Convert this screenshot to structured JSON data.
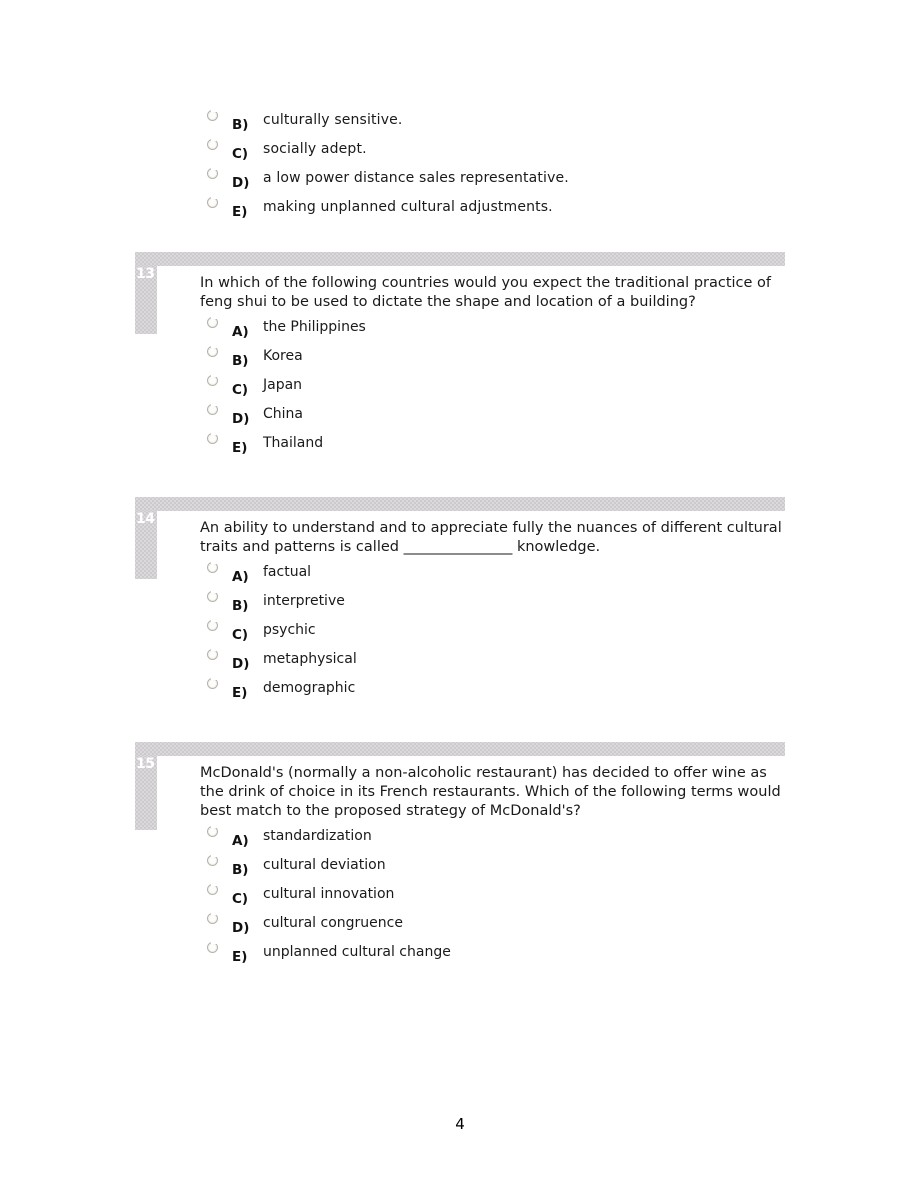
{
  "document": {
    "page_number": "4"
  },
  "continued_options": [
    {
      "letter": "B)",
      "text": "culturally sensitive."
    },
    {
      "letter": "C)",
      "text": "socially adept."
    },
    {
      "letter": "D)",
      "text": "a low power distance sales representative."
    },
    {
      "letter": "E)",
      "text": "making unplanned cultural adjustments."
    }
  ],
  "questions": [
    {
      "number": "13",
      "text": "In which of the following countries would you expect the traditional practice of feng shui to be used to dictate the shape and location of a building?",
      "options": [
        {
          "letter": "A)",
          "text": "the Philippines"
        },
        {
          "letter": "B)",
          "text": "Korea"
        },
        {
          "letter": "C)",
          "text": "Japan"
        },
        {
          "letter": "D)",
          "text": "China"
        },
        {
          "letter": "E)",
          "text": "Thailand"
        }
      ]
    },
    {
      "number": "14",
      "text": "An ability to understand and to appreciate fully the nuances of different cultural traits and patterns is called _______________ knowledge.",
      "options": [
        {
          "letter": "A)",
          "text": "factual"
        },
        {
          "letter": "B)",
          "text": "interpretive"
        },
        {
          "letter": "C)",
          "text": "psychic"
        },
        {
          "letter": "D)",
          "text": "metaphysical"
        },
        {
          "letter": "E)",
          "text": "demographic"
        }
      ]
    },
    {
      "number": "15",
      "text": "McDonald's (normally a non-alcoholic restaurant) has decided to offer wine as the drink of choice in its French restaurants. Which of the following terms would best match to the proposed strategy of McDonald's?",
      "options": [
        {
          "letter": "A)",
          "text": "standardization"
        },
        {
          "letter": "B)",
          "text": "cultural deviation"
        },
        {
          "letter": "C)",
          "text": "cultural innovation"
        },
        {
          "letter": "D)",
          "text": "cultural congruence"
        },
        {
          "letter": "E)",
          "text": "unplanned cultural change"
        }
      ]
    }
  ],
  "colors": {
    "bar_gray": "#cbcbcb",
    "bar_dot": "#e2dce4",
    "number_text": "#ffffff",
    "body_text": "#1a1a1a"
  }
}
